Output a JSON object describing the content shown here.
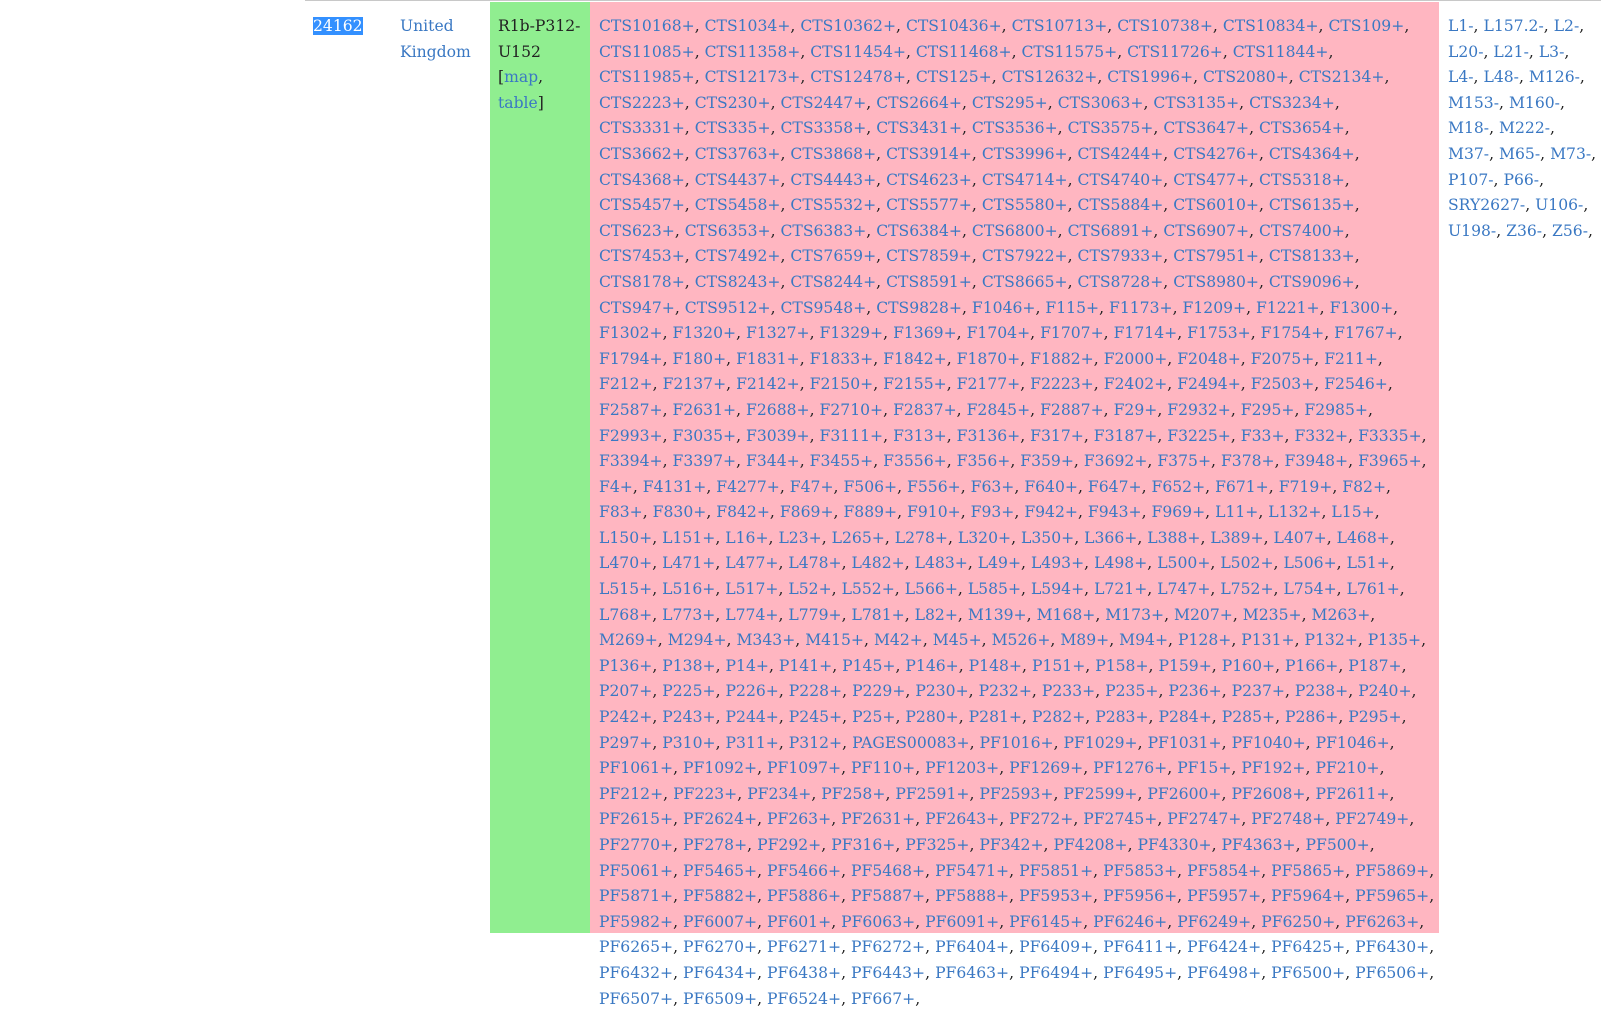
{
  "sample": {
    "id": "24162",
    "country": "United Kingdom",
    "haplogroup": "R1b-P312-U152",
    "map_label": "map",
    "table_label": "table"
  },
  "colors": {
    "link": "#3a78c3",
    "positive_bg": "#ffb6c1",
    "haplogroup_bg": "#90ee90",
    "selection": "#3390ff"
  },
  "positive_markers": [
    "CTS10168+",
    "CTS1034+",
    "CTS10362+",
    "CTS10436+",
    "CTS10713+",
    "CTS10738+",
    "CTS10834+",
    "CTS109+",
    "CTS11085+",
    "CTS11358+",
    "CTS11454+",
    "CTS11468+",
    "CTS11575+",
    "CTS11726+",
    "CTS11844+",
    "CTS11985+",
    "CTS12173+",
    "CTS12478+",
    "CTS125+",
    "CTS12632+",
    "CTS1996+",
    "CTS2080+",
    "CTS2134+",
    "CTS2223+",
    "CTS230+",
    "CTS2447+",
    "CTS2664+",
    "CTS295+",
    "CTS3063+",
    "CTS3135+",
    "CTS3234+",
    "CTS3331+",
    "CTS335+",
    "CTS3358+",
    "CTS3431+",
    "CTS3536+",
    "CTS3575+",
    "CTS3647+",
    "CTS3654+",
    "CTS3662+",
    "CTS3763+",
    "CTS3868+",
    "CTS3914+",
    "CTS3996+",
    "CTS4244+",
    "CTS4276+",
    "CTS4364+",
    "CTS4368+",
    "CTS4437+",
    "CTS4443+",
    "CTS4623+",
    "CTS4714+",
    "CTS4740+",
    "CTS477+",
    "CTS5318+",
    "CTS5457+",
    "CTS5458+",
    "CTS5532+",
    "CTS5577+",
    "CTS5580+",
    "CTS5884+",
    "CTS6010+",
    "CTS6135+",
    "CTS623+",
    "CTS6353+",
    "CTS6383+",
    "CTS6384+",
    "CTS6800+",
    "CTS6891+",
    "CTS6907+",
    "CTS7400+",
    "CTS7453+",
    "CTS7492+",
    "CTS7659+",
    "CTS7859+",
    "CTS7922+",
    "CTS7933+",
    "CTS7951+",
    "CTS8133+",
    "CTS8178+",
    "CTS8243+",
    "CTS8244+",
    "CTS8591+",
    "CTS8665+",
    "CTS8728+",
    "CTS8980+",
    "CTS9096+",
    "CTS947+",
    "CTS9512+",
    "CTS9548+",
    "CTS9828+",
    "F1046+",
    "F115+",
    "F1173+",
    "F1209+",
    "F1221+",
    "F1300+",
    "F1302+",
    "F1320+",
    "F1327+",
    "F1329+",
    "F1369+",
    "F1704+",
    "F1707+",
    "F1714+",
    "F1753+",
    "F1754+",
    "F1767+",
    "F1794+",
    "F180+",
    "F1831+",
    "F1833+",
    "F1842+",
    "F1870+",
    "F1882+",
    "F2000+",
    "F2048+",
    "F2075+",
    "F211+",
    "F212+",
    "F2137+",
    "F2142+",
    "F2150+",
    "F2155+",
    "F2177+",
    "F2223+",
    "F2402+",
    "F2494+",
    "F2503+",
    "F2546+",
    "F2587+",
    "F2631+",
    "F2688+",
    "F2710+",
    "F2837+",
    "F2845+",
    "F2887+",
    "F29+",
    "F2932+",
    "F295+",
    "F2985+",
    "F2993+",
    "F3035+",
    "F3039+",
    "F3111+",
    "F313+",
    "F3136+",
    "F317+",
    "F3187+",
    "F3225+",
    "F33+",
    "F332+",
    "F3335+",
    "F3394+",
    "F3397+",
    "F344+",
    "F3455+",
    "F3556+",
    "F356+",
    "F359+",
    "F3692+",
    "F375+",
    "F378+",
    "F3948+",
    "F3965+",
    "F4+",
    "F4131+",
    "F4277+",
    "F47+",
    "F506+",
    "F556+",
    "F63+",
    "F640+",
    "F647+",
    "F652+",
    "F671+",
    "F719+",
    "F82+",
    "F83+",
    "F830+",
    "F842+",
    "F869+",
    "F889+",
    "F910+",
    "F93+",
    "F942+",
    "F943+",
    "F969+",
    "L11+",
    "L132+",
    "L15+",
    "L150+",
    "L151+",
    "L16+",
    "L23+",
    "L265+",
    "L278+",
    "L320+",
    "L350+",
    "L366+",
    "L388+",
    "L389+",
    "L407+",
    "L468+",
    "L470+",
    "L471+",
    "L477+",
    "L478+",
    "L482+",
    "L483+",
    "L49+",
    "L493+",
    "L498+",
    "L500+",
    "L502+",
    "L506+",
    "L51+",
    "L515+",
    "L516+",
    "L517+",
    "L52+",
    "L552+",
    "L566+",
    "L585+",
    "L594+",
    "L721+",
    "L747+",
    "L752+",
    "L754+",
    "L761+",
    "L768+",
    "L773+",
    "L774+",
    "L779+",
    "L781+",
    "L82+",
    "M139+",
    "M168+",
    "M173+",
    "M207+",
    "M235+",
    "M263+",
    "M269+",
    "M294+",
    "M343+",
    "M415+",
    "M42+",
    "M45+",
    "M526+",
    "M89+",
    "M94+",
    "P128+",
    "P131+",
    "P132+",
    "P135+",
    "P136+",
    "P138+",
    "P14+",
    "P141+",
    "P145+",
    "P146+",
    "P148+",
    "P151+",
    "P158+",
    "P159+",
    "P160+",
    "P166+",
    "P187+",
    "P207+",
    "P225+",
    "P226+",
    "P228+",
    "P229+",
    "P230+",
    "P232+",
    "P233+",
    "P235+",
    "P236+",
    "P237+",
    "P238+",
    "P240+",
    "P242+",
    "P243+",
    "P244+",
    "P245+",
    "P25+",
    "P280+",
    "P281+",
    "P282+",
    "P283+",
    "P284+",
    "P285+",
    "P286+",
    "P295+",
    "P297+",
    "P310+",
    "P311+",
    "P312+",
    "PAGES00083+",
    "PF1016+",
    "PF1029+",
    "PF1031+",
    "PF1040+",
    "PF1046+",
    "PF1061+",
    "PF1092+",
    "PF1097+",
    "PF110+",
    "PF1203+",
    "PF1269+",
    "PF1276+",
    "PF15+",
    "PF192+",
    "PF210+",
    "PF212+",
    "PF223+",
    "PF234+",
    "PF258+",
    "PF2591+",
    "PF2593+",
    "PF2599+",
    "PF2600+",
    "PF2608+",
    "PF2611+",
    "PF2615+",
    "PF2624+",
    "PF263+",
    "PF2631+",
    "PF2643+",
    "PF272+",
    "PF2745+",
    "PF2747+",
    "PF2748+",
    "PF2749+",
    "PF2770+",
    "PF278+",
    "PF292+",
    "PF316+",
    "PF325+",
    "PF342+",
    "PF4208+",
    "PF4330+",
    "PF4363+",
    "PF500+",
    "PF5061+",
    "PF5465+",
    "PF5466+",
    "PF5468+",
    "PF5471+",
    "PF5851+",
    "PF5853+",
    "PF5854+",
    "PF5865+",
    "PF5869+",
    "PF5871+",
    "PF5882+",
    "PF5886+",
    "PF5887+",
    "PF5888+",
    "PF5953+",
    "PF5956+",
    "PF5957+",
    "PF5964+",
    "PF5965+",
    "PF5982+",
    "PF6007+",
    "PF601+",
    "PF6063+",
    "PF6091+",
    "PF6145+",
    "PF6246+",
    "PF6249+",
    "PF6250+",
    "PF6263+",
    "PF6265+",
    "PF6270+",
    "PF6271+",
    "PF6272+",
    "PF6404+",
    "PF6409+",
    "PF6411+",
    "PF6424+",
    "PF6425+",
    "PF6430+",
    "PF6432+",
    "PF6434+",
    "PF6438+",
    "PF6443+",
    "PF6463+",
    "PF6494+",
    "PF6495+",
    "PF6498+",
    "PF6500+",
    "PF6506+",
    "PF6507+",
    "PF6509+",
    "PF6524+",
    "PF667+"
  ],
  "negative_markers": [
    "L1-",
    "L157.2-",
    "L2-",
    "L20-",
    "L21-",
    "L3-",
    "L4-",
    "L48-",
    "M126-",
    "M153-",
    "M160-",
    "M18-",
    "M222-",
    "M37-",
    "M65-",
    "M73-",
    "P107-",
    "P66-",
    "SRY2627-",
    "U106-",
    "U198-",
    "Z36-",
    "Z56-"
  ]
}
